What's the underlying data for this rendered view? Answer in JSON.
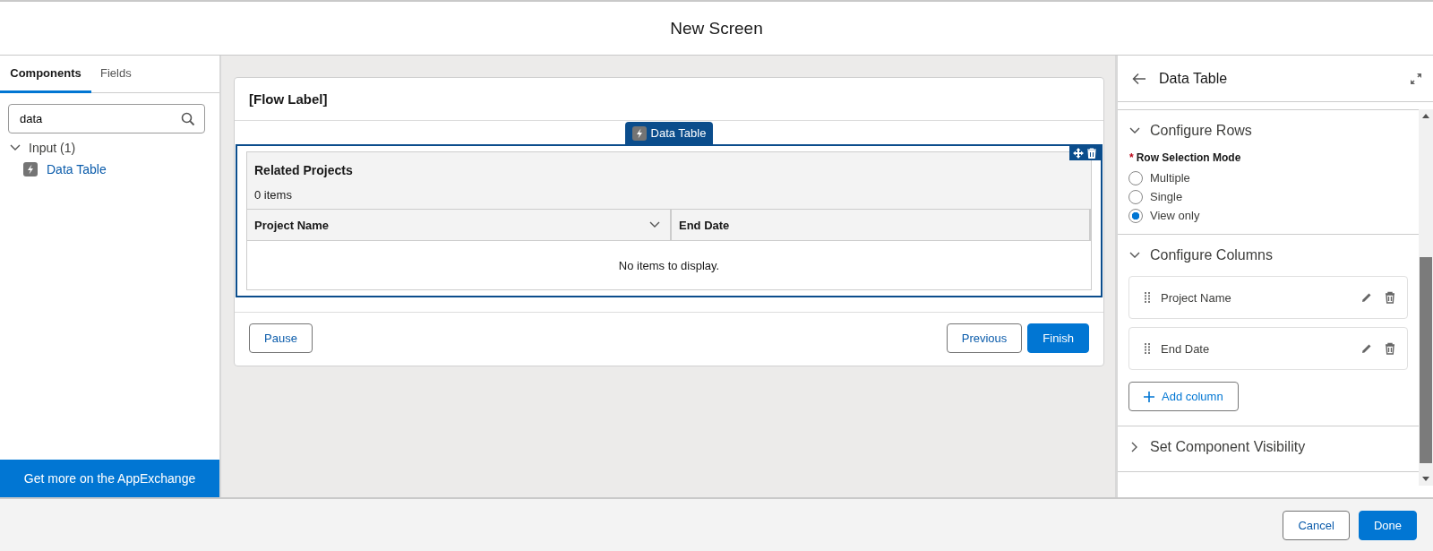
{
  "modal": {
    "title": "New Screen"
  },
  "palette": {
    "tabs": [
      {
        "label": "Components",
        "selected": true
      },
      {
        "label": "Fields",
        "selected": false
      }
    ],
    "search": {
      "value": "data"
    },
    "groups": [
      {
        "label": "Input (1)",
        "expanded": true,
        "children": [
          {
            "label": "Data Table"
          }
        ]
      }
    ],
    "appexchange_link": "Get more on the AppExchange"
  },
  "canvas": {
    "flow_label": "[Flow Label]",
    "component_tag": "Data Table",
    "selected": true,
    "table": {
      "title": "Related Projects",
      "count": "0 items",
      "columns": [
        {
          "label": "Project Name",
          "menu": true
        },
        {
          "label": "End Date",
          "menu": false
        }
      ],
      "empty_message": "No items to display."
    },
    "left_buttons": [
      {
        "label": "Pause",
        "kind": "neutral"
      }
    ],
    "right_buttons": [
      {
        "label": "Previous",
        "kind": "neutral"
      },
      {
        "label": "Finish",
        "kind": "brand"
      }
    ]
  },
  "properties": {
    "title": "Data Table",
    "sections": [
      {
        "kind": "radio",
        "title": "Configure Rows",
        "expanded": true,
        "field_label": "Row Selection Mode",
        "required_mark": "*",
        "options": [
          {
            "label": "Multiple",
            "selected": false
          },
          {
            "label": "Single",
            "selected": false
          },
          {
            "label": "View only",
            "selected": true
          }
        ]
      },
      {
        "kind": "columns",
        "title": "Configure Columns",
        "expanded": true,
        "items": [
          {
            "label": "Project Name"
          },
          {
            "label": "End Date"
          }
        ],
        "add_button": "Add column"
      },
      {
        "kind": "collapsed",
        "title": "Set Component Visibility",
        "expanded": false
      }
    ]
  },
  "footer": {
    "buttons": [
      {
        "label": "Cancel",
        "kind": "neutral"
      },
      {
        "label": "Done",
        "kind": "brand"
      }
    ]
  }
}
